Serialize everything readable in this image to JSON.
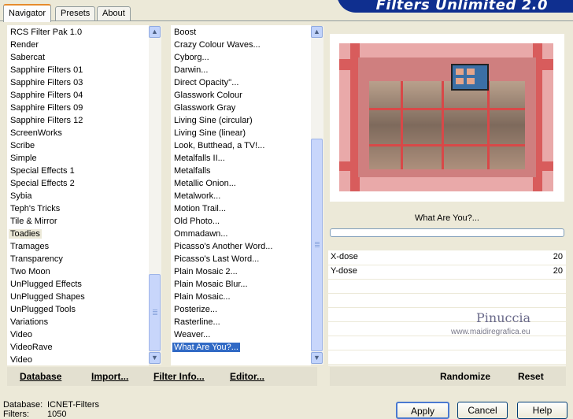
{
  "app": {
    "title": "Filters Unlimited 2.0"
  },
  "tabs": [
    {
      "label": "Navigator",
      "active": true
    },
    {
      "label": "Presets",
      "active": false
    },
    {
      "label": "About",
      "active": false
    }
  ],
  "categories": {
    "items": [
      "RCS Filter Pak 1.0",
      "Render",
      "Sabercat",
      "Sapphire Filters 01",
      "Sapphire Filters 03",
      "Sapphire Filters 04",
      "Sapphire Filters 09",
      "Sapphire Filters 12",
      "ScreenWorks",
      "Scribe",
      "Simple",
      "Special Effects 1",
      "Special Effects 2",
      "Sybia",
      "Teph's Tricks",
      "Tile & Mirror",
      "Toadies",
      "Tramages",
      "Transparency",
      "Two Moon",
      "UnPlugged Effects",
      "UnPlugged Shapes",
      "UnPlugged Tools",
      "Variations",
      "Video",
      "VideoRave",
      "Video"
    ],
    "selected_index": 16
  },
  "filters": {
    "items": [
      "Boost",
      "Crazy Colour Waves...",
      "Cyborg...",
      "Darwin...",
      "Direct Opacity''...",
      "Glasswork Colour",
      "Glasswork Gray",
      "Living Sine (circular)",
      "Living Sine (linear)",
      "Look, Butthead, a TV!...",
      "Metalfalls II...",
      "Metalfalls",
      "Metallic Onion...",
      "Metalwork...",
      "Motion Trail...",
      "Old Photo...",
      "Ommadawn...",
      "Picasso's Another Word...",
      "Picasso's Last Word...",
      "Plain Mosaic 2...",
      "Plain Mosaic Blur...",
      "Plain Mosaic...",
      "Posterize...",
      "Rasterline...",
      "Weaver...",
      "What Are You?..."
    ],
    "selected_index": 25
  },
  "preview": {
    "caption": "What Are You?...",
    "progress": 0
  },
  "parameters": [
    {
      "label": "X-dose",
      "value": "20"
    },
    {
      "label": "Y-dose",
      "value": "20"
    }
  ],
  "watermark": {
    "name": "Pinuccia",
    "url": "www.maidiregrafica.eu"
  },
  "left_buttons": {
    "database": "Database",
    "import": "Import...",
    "filter_info": "Filter Info...",
    "editor": "Editor..."
  },
  "right_buttons": {
    "randomize": "Randomize",
    "reset": "Reset"
  },
  "status": {
    "database_label": "Database:",
    "database_value": "ICNET-Filters",
    "filters_label": "Filters:",
    "filters_value": "1050"
  },
  "dialog_buttons": {
    "apply": "Apply",
    "cancel": "Cancel",
    "help": "Help"
  },
  "colors": {
    "selection": "#316ac5",
    "banner": "#0f2f8f",
    "window": "#ece9d8"
  }
}
